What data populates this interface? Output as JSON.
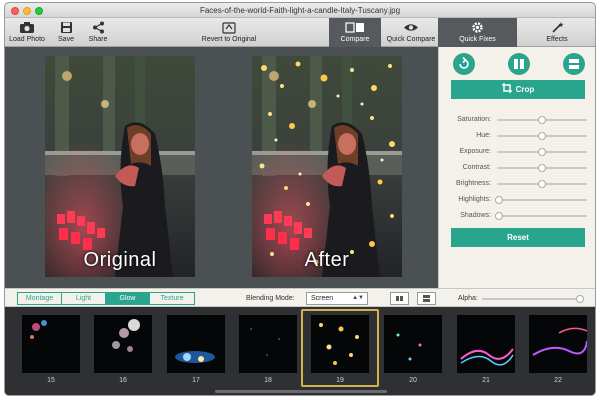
{
  "window": {
    "title": "Faces-of-the-world-Faith-light-a-candle-Italy-Tuscany.jpg"
  },
  "toolbar": {
    "load_photo": "Load Photo",
    "save": "Save",
    "share": "Share",
    "revert": "Revert to Original",
    "compare": "Compare",
    "quick_compare": "Quick Compare",
    "quick_fixes": "Quick Fixes",
    "effects": "Effects"
  },
  "canvas": {
    "original_label": "Original",
    "after_label": "After"
  },
  "sidebar": {
    "crop_label": "Crop",
    "sliders": [
      {
        "label": "Saturation:",
        "value": 0.5
      },
      {
        "label": "Hue:",
        "value": 0.5
      },
      {
        "label": "Exposure:",
        "value": 0.5
      },
      {
        "label": "Contrast:",
        "value": 0.5
      },
      {
        "label": "Brightness:",
        "value": 0.5
      },
      {
        "label": "Highlights:",
        "value": 0.02
      },
      {
        "label": "Shadows:",
        "value": 0.02
      }
    ],
    "reset_label": "Reset"
  },
  "bottombar": {
    "categories": [
      "Montage",
      "Light",
      "Glow",
      "Texture"
    ],
    "active_category": "Glow",
    "blending_label": "Blending Mode:",
    "blending_value": "Screen",
    "alpha_label": "Alpha:",
    "alpha_value": 0.98
  },
  "filmstrip": {
    "thumbnails": [
      "15",
      "16",
      "17",
      "18",
      "19",
      "20",
      "21",
      "22"
    ],
    "selected": "19"
  },
  "colors": {
    "accent": "#2aa58d",
    "selection": "#d4b24a"
  },
  "icons": {
    "load_photo": "camera-icon",
    "save": "floppy-icon",
    "share": "share-icon",
    "revert": "revert-icon",
    "compare": "compare-icon",
    "quick_compare": "eye-icon",
    "quick_fixes": "gear-icon",
    "effects": "magic-wand-icon"
  }
}
